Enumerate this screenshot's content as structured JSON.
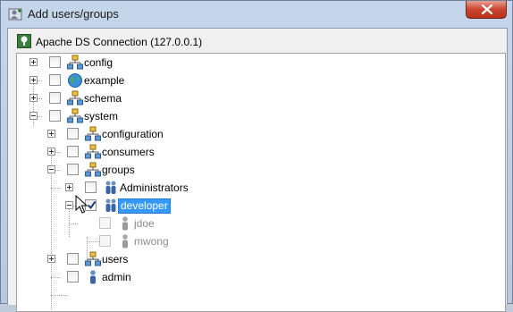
{
  "window": {
    "title": "Add users/groups",
    "icon": "add-user-icon",
    "close_icon": "close-icon"
  },
  "connection": {
    "label": "Apache DS Connection (127.0.0.1)",
    "icon": "connection-tree-icon"
  },
  "tree": {
    "items": [
      {
        "label": "config",
        "icon": "organization-icon",
        "expander": "plus",
        "checked": false
      },
      {
        "label": "example",
        "icon": "globe-icon",
        "expander": "plus",
        "checked": false
      },
      {
        "label": "schema",
        "icon": "organization-icon",
        "expander": "plus",
        "checked": false
      },
      {
        "label": "system",
        "icon": "organization-icon",
        "expander": "minus",
        "checked": false
      },
      {
        "label": "configuration",
        "icon": "organization-icon",
        "expander": "plus",
        "checked": false
      },
      {
        "label": "consumers",
        "icon": "organization-icon",
        "expander": "plus",
        "checked": false
      },
      {
        "label": "groups",
        "icon": "organization-icon",
        "expander": "minus",
        "checked": false
      },
      {
        "label": "Administrators",
        "icon": "group-icon",
        "expander": "plus",
        "checked": false
      },
      {
        "label": "developer",
        "icon": "group-icon",
        "expander": "minus",
        "checked": true,
        "selected": true
      },
      {
        "label": "jdoe",
        "icon": "user-icon",
        "checked": false,
        "disabled": true
      },
      {
        "label": "mwong",
        "icon": "user-icon",
        "checked": false,
        "disabled": true
      },
      {
        "label": "users",
        "icon": "organization-icon",
        "expander": "plus",
        "checked": false
      },
      {
        "label": "admin",
        "icon": "user-icon",
        "checked": false
      }
    ]
  },
  "colors": {
    "selection": "#3399ff",
    "tree_background": "#ffffff",
    "dialog_background": "#f0f0f0",
    "close_button": "#c9452f"
  }
}
